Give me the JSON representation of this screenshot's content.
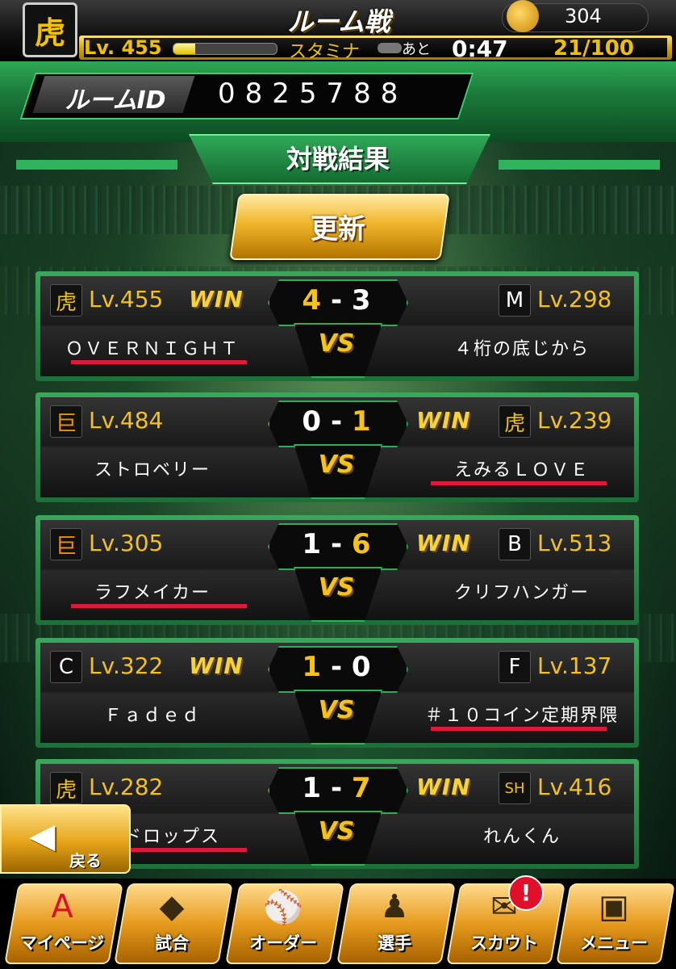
{
  "header": {
    "title": "ルーム戦",
    "coin_count": "304",
    "level": "Lv. 455",
    "stamina_label": "スタミナ",
    "stamina_fraction": 0.21,
    "time_prefix": "あと",
    "timer": "0:47",
    "stamina_value": "21/100",
    "team_logo_icon": "tigers-logo-icon"
  },
  "room": {
    "id_label": "ルームID",
    "id_value": "0825788"
  },
  "results_title": "対戦結果",
  "refresh_label": "更新",
  "matches": [
    {
      "left_logo": "虎",
      "left_logo_color": "#f2c200",
      "left_lv": "Lv.455",
      "left_win": "WIN",
      "right_win": "",
      "score_left": "4",
      "score_right": "3",
      "winner": "left",
      "right_logo": "M",
      "right_logo_color": "#ffffff",
      "right_lv": "Lv.298",
      "left_name": "ＯＶＥＲＮＩＧＨＴ",
      "right_name": "４桁の底じから",
      "vs": "VS",
      "underline": "left"
    },
    {
      "left_logo": "巨",
      "left_logo_color": "#f39200",
      "left_lv": "Lv.484",
      "left_win": "",
      "right_win": "WIN",
      "score_left": "0",
      "score_right": "1",
      "winner": "right",
      "right_logo": "虎",
      "right_logo_color": "#f2c200",
      "right_lv": "Lv.239",
      "left_name": "ストロベリー",
      "right_name": "えみるＬＯＶＥ",
      "vs": "VS",
      "underline": "right"
    },
    {
      "left_logo": "巨",
      "left_logo_color": "#f39200",
      "left_lv": "Lv.305",
      "left_win": "",
      "right_win": "WIN",
      "score_left": "1",
      "score_right": "6",
      "winner": "right",
      "right_logo": "B",
      "right_logo_color": "#ffffff",
      "right_lv": "Lv.513",
      "left_name": "ラフメイカー",
      "right_name": "クリフハンガー",
      "vs": "VS",
      "underline": "left"
    },
    {
      "left_logo": "C",
      "left_logo_color": "#ffffff",
      "left_lv": "Lv.322",
      "left_win": "WIN",
      "right_win": "",
      "score_left": "1",
      "score_right": "0",
      "winner": "left",
      "right_logo": "F",
      "right_logo_color": "#ffffff",
      "right_lv": "Lv.137",
      "left_name": "Ｆａｄｅｄ",
      "right_name": "＃１０コイン定期界隈",
      "vs": "VS",
      "underline": "right"
    },
    {
      "left_logo": "虎",
      "left_logo_color": "#f2c200",
      "left_lv": "Lv.282",
      "left_win": "",
      "right_win": "WIN",
      "score_left": "1",
      "score_right": "7",
      "winner": "right",
      "right_logo": "SH",
      "right_logo_color": "#f2c200",
      "right_lv": "Lv.416",
      "left_name": "優勝ドロップス",
      "right_name": "れんくん",
      "vs": "VS",
      "underline": "left"
    }
  ],
  "back_label": "戻る",
  "nav": [
    {
      "label": "マイページ",
      "icon": "A"
    },
    {
      "label": "試合",
      "icon": "◆"
    },
    {
      "label": "オーダー",
      "icon": "⚾"
    },
    {
      "label": "選手",
      "icon": "♟"
    },
    {
      "label": "スカウト",
      "icon": "✉"
    },
    {
      "label": "メニュー",
      "icon": "▣"
    }
  ],
  "scout_badge": "!"
}
